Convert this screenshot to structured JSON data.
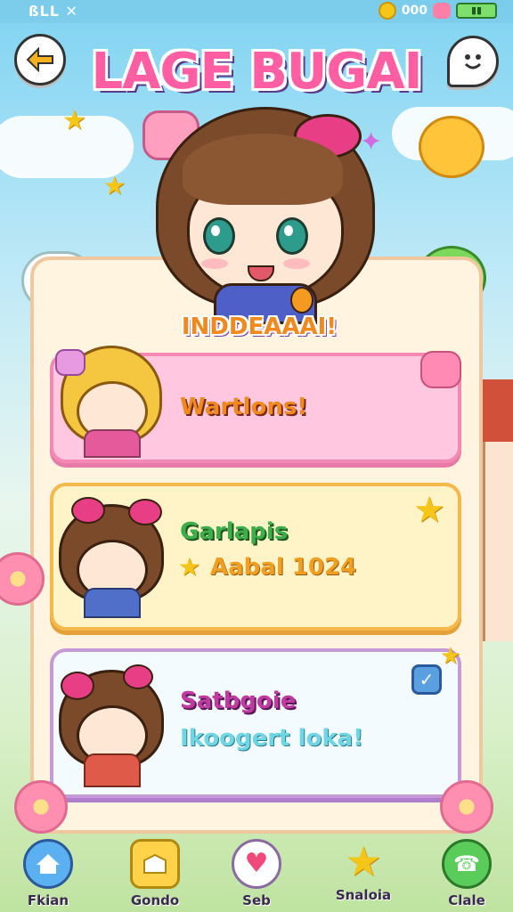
{
  "status_bar": {
    "left_text": "ßLL ✕",
    "coins": "000"
  },
  "header": {
    "title": "LAGE BUGAI"
  },
  "hero": {
    "label": "INDDEAAAI!"
  },
  "cards": [
    {
      "title": "Wartlons!",
      "subtitle": "",
      "colors": {
        "title": "#f08a1e"
      }
    },
    {
      "title": "Garlapis",
      "subtitle": "Aabal 1024",
      "colors": {
        "title": "#3cae4a",
        "subtitle": "#f0a020"
      }
    },
    {
      "title": "Satbgoie",
      "subtitle": "Ikoogert loka!",
      "colors": {
        "title": "#c03aa0",
        "subtitle": "#6fd6e6"
      }
    }
  ],
  "nav": [
    {
      "label": "Fkian",
      "icon": "home-icon"
    },
    {
      "label": "Gondo",
      "icon": "shop-icon"
    },
    {
      "label": "Seb",
      "icon": "heart-icon"
    },
    {
      "label": "Snaloia",
      "icon": "star-icon"
    },
    {
      "label": "Clale",
      "icon": "phone-icon"
    }
  ],
  "colors": {
    "accent_pink": "#ff5fa2",
    "accent_orange": "#f08a1e",
    "panel": "#fff4e0"
  }
}
